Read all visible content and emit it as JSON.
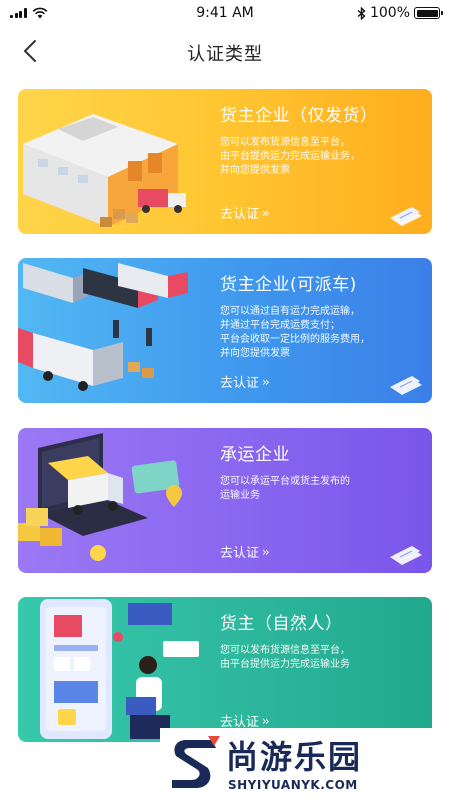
{
  "status_bar": {
    "time": "9:41 AM",
    "battery": "100%"
  },
  "nav": {
    "title": "认证类型"
  },
  "cards": [
    {
      "title": "货主企业（仅发货）",
      "desc": [
        "您可以发布货源信息至平台，",
        "由平台提供运力完成运输业务，",
        "并向您提供发票"
      ],
      "link": "去认证"
    },
    {
      "title": "货主企业(可派车)",
      "desc": [
        "您可以通过自有运力完成运输，",
        "并通过平台完成运费支付；",
        "平台会收取一定比例的服务费用，",
        "并向您提供发票"
      ],
      "link": "去认证"
    },
    {
      "title": "承运企业",
      "desc": [
        "您可以承运平台或货主发布的",
        "运输业务"
      ],
      "link": "去认证"
    },
    {
      "title": "货主（自然人）",
      "desc": [
        "您可以发布货源信息至平台，",
        "由平台提供运力完成运输业务"
      ],
      "link": "去认证"
    }
  ],
  "watermark": {
    "title": "尚游乐园",
    "subtitle": "SHYIYUANYK.COM"
  },
  "colors": {
    "card1": "#ffc531",
    "card2": "#3f98ee",
    "card3": "#8966ef",
    "card4": "#2db79c"
  }
}
